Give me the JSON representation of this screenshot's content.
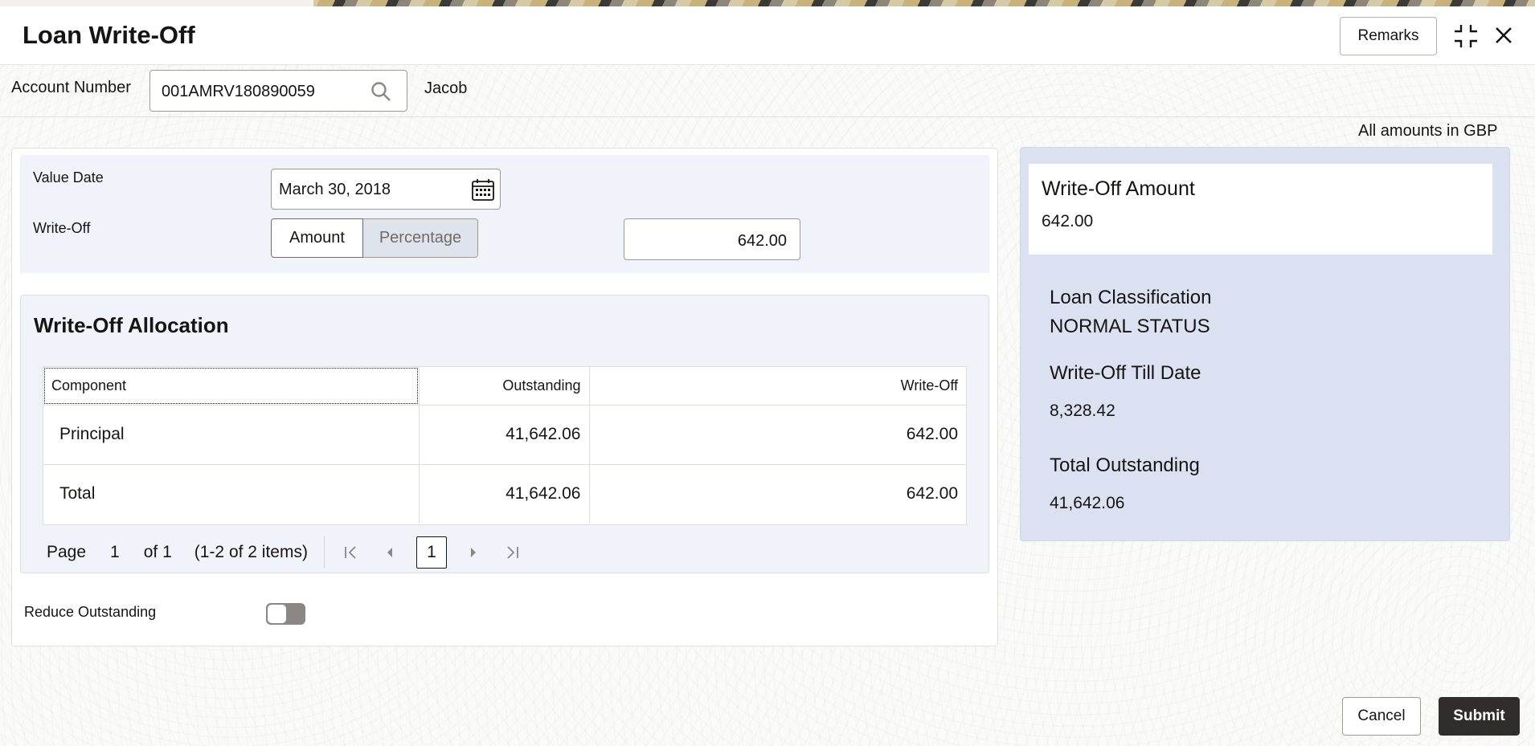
{
  "header": {
    "title": "Loan Write-Off",
    "remarks_label": "Remarks"
  },
  "account": {
    "label": "Account Number",
    "value": "001AMRV180890059",
    "name": "Jacob"
  },
  "amounts_note": "All amounts in GBP",
  "form": {
    "value_date_label": "Value Date",
    "value_date": "March 30, 2018",
    "writeoff_label": "Write-Off",
    "writeoff_options": [
      "Amount",
      "Percentage"
    ],
    "writeoff_selected": "Amount",
    "writeoff_amount": "642.00"
  },
  "allocation": {
    "title": "Write-Off Allocation",
    "columns": [
      "Component",
      "Outstanding",
      "Write-Off"
    ],
    "rows": [
      {
        "component": "Principal",
        "outstanding": "41,642.06",
        "writeoff": "642.00"
      },
      {
        "component": "Total",
        "outstanding": "41,642.06",
        "writeoff": "642.00"
      }
    ],
    "pagination": {
      "page_label": "Page",
      "current_page": "1",
      "of_text": "of 1",
      "items_text": "(1-2 of 2 items)",
      "page_box": "1"
    }
  },
  "reduce_outstanding": {
    "label": "Reduce Outstanding",
    "enabled": false
  },
  "summary": {
    "writeoff_amount_label": "Write-Off Amount",
    "writeoff_amount_value": "642.00",
    "loan_classification_label": "Loan Classification",
    "loan_classification_value": "NORMAL STATUS",
    "writeoff_till_date_label": "Write-Off Till Date",
    "writeoff_till_date_value": "8,328.42",
    "total_outstanding_label": "Total Outstanding",
    "total_outstanding_value": "41,642.06"
  },
  "footer": {
    "cancel_label": "Cancel",
    "submit_label": "Submit"
  },
  "colors": {
    "panel_bg": "#f0f3fa",
    "summary_bg": "#dce1f1",
    "primary_button": "#312d2a"
  },
  "icons": [
    "search-icon",
    "calendar-icon",
    "minimize-icon",
    "close-icon",
    "first-page-icon",
    "prev-page-icon",
    "next-page-icon",
    "last-page-icon"
  ]
}
